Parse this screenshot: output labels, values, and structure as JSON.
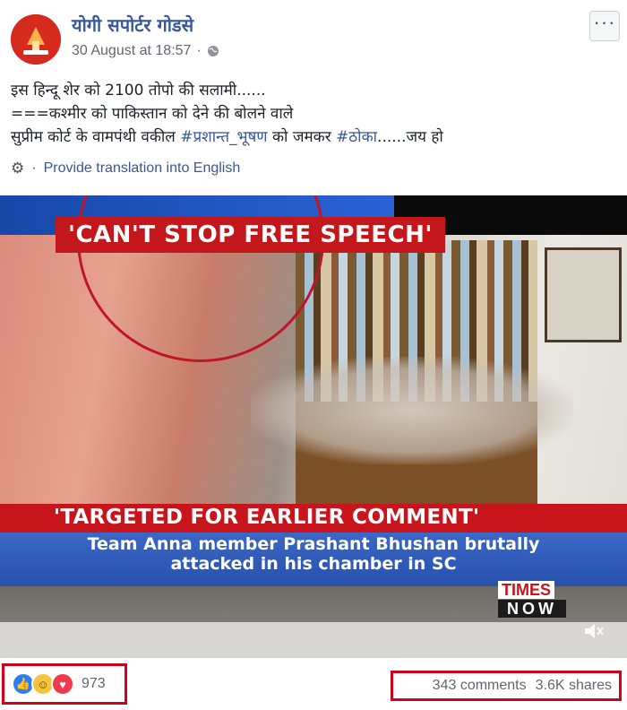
{
  "post": {
    "page_name": "योगी सपोर्टर गोडसे",
    "timestamp": "30 August at 18:57",
    "separator": "·",
    "privacy_icon": "globe-icon",
    "more_label": "···",
    "text_line1": "इस हिन्दू शेर को 2100 तोपो की सलामी......",
    "text_line2": "===कश्मीर को पाकिस्तान को देने की बोलने वाले",
    "text_line3_prefix": "सुप्रीम कोर्ट के वामपंथी वकील ",
    "hashtag1": "#प्रशान्त_भूषण",
    "text_line3_mid": " को जमकर ",
    "hashtag2": "#ठोका",
    "text_line3_suffix": "......जय हो",
    "translate_icon": "gear-icon",
    "translate_label": "Provide translation into English"
  },
  "video": {
    "headline": "'CAN'T STOP FREE SPEECH'",
    "subheadline": "'TARGETED FOR EARLIER COMMENT'",
    "caption_line1": "Team Anna member Prashant Bhushan brutally",
    "caption_line2": "attacked in his chamber in SC",
    "logo_top": "TIMES",
    "logo_bottom": "NOW",
    "mute_icon": "speaker-muted-icon"
  },
  "footer": {
    "reaction_icons": [
      "like-icon",
      "haha-icon",
      "love-icon"
    ],
    "reaction_count": "973",
    "comments": "343 comments",
    "shares": "3.6K shares"
  },
  "colors": {
    "link": "#385898",
    "highlight_box": "#d0021b",
    "news_red": "#c4171c",
    "news_blue": "#2751ad"
  }
}
